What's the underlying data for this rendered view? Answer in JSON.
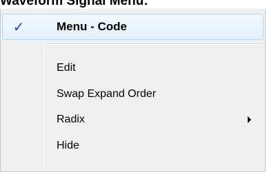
{
  "page": {
    "title": "Waveform Signal Menu:"
  },
  "menu": {
    "header_item": {
      "label": "Menu - Code",
      "checked": true,
      "check_glyph": "✓"
    },
    "items": [
      {
        "label": "Edit",
        "has_submenu": false
      },
      {
        "label": "Swap Expand Order",
        "has_submenu": false
      },
      {
        "label": "Radix",
        "has_submenu": true
      },
      {
        "label": "Hide",
        "has_submenu": false
      }
    ]
  },
  "colors": {
    "menu_background": "#f0f0f0",
    "highlight_border": "#b7d6f1",
    "check_color": "#1c4a99"
  }
}
